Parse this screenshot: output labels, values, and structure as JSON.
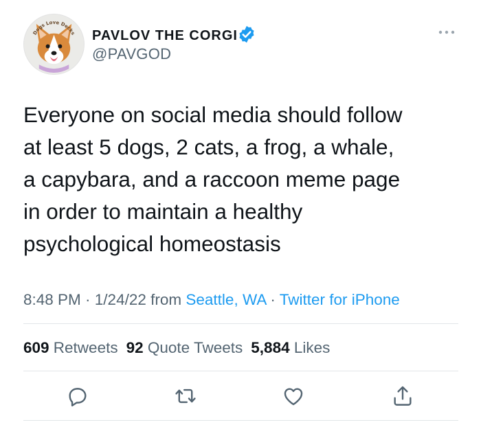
{
  "author": {
    "name": "PAVLOV THE CORGI",
    "handle": "@PAVGOD",
    "avatar_text": "Dogs Love Decks",
    "verified": true
  },
  "tweet": {
    "text": "Everyone on social media should follow\nat least 5 dogs, 2 cats, a frog, a whale,\na capybara, and a raccoon meme page\nin order to maintain a healthy\npsychological homeostasis"
  },
  "meta": {
    "time": "8:48 PM",
    "sep1": " · ",
    "date": "1/24/22",
    "from_word": " from ",
    "location": "Seattle, WA",
    "sep2": " · ",
    "source": "Twitter for iPhone"
  },
  "stats": {
    "retweets_count": "609",
    "retweets_label": " Retweets",
    "quotes_count": "92",
    "quotes_label": " Quote Tweets",
    "likes_count": "5,884",
    "likes_label": " Likes"
  },
  "icons": {
    "reply": "reply-icon",
    "retweet": "retweet-icon",
    "like": "like-icon",
    "share": "share-icon",
    "more": "more-icon",
    "verified": "verified-badge-icon"
  },
  "colors": {
    "accent": "#1d9bf0",
    "text": "#0f1419",
    "secondary": "#536471",
    "divider": "#e1e5e8"
  }
}
